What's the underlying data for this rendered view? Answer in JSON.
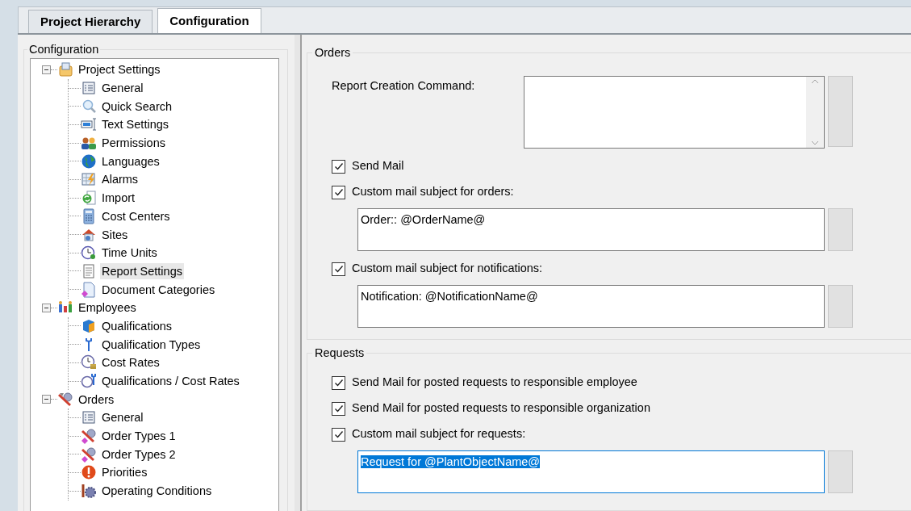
{
  "tabs": [
    {
      "label": "Project Hierarchy",
      "selected": false
    },
    {
      "label": "Configuration",
      "selected": true
    }
  ],
  "left_panel": {
    "title": "Configuration",
    "tree": [
      {
        "label": "Project Settings",
        "expanded": true,
        "selected": false,
        "children": [
          {
            "label": "General",
            "selected": false
          },
          {
            "label": "Quick Search",
            "selected": false
          },
          {
            "label": "Text Settings",
            "selected": false
          },
          {
            "label": "Permissions",
            "selected": false
          },
          {
            "label": "Languages",
            "selected": false
          },
          {
            "label": "Alarms",
            "selected": false
          },
          {
            "label": "Import",
            "selected": false
          },
          {
            "label": "Cost Centers",
            "selected": false
          },
          {
            "label": "Sites",
            "selected": false
          },
          {
            "label": "Time Units",
            "selected": false
          },
          {
            "label": "Report Settings",
            "selected": true
          },
          {
            "label": "Document Categories",
            "selected": false
          }
        ]
      },
      {
        "label": "Employees",
        "expanded": true,
        "selected": false,
        "children": [
          {
            "label": "Qualifications",
            "selected": false
          },
          {
            "label": "Qualification Types",
            "selected": false
          },
          {
            "label": "Cost Rates",
            "selected": false
          },
          {
            "label": "Qualifications / Cost Rates",
            "selected": false
          }
        ]
      },
      {
        "label": "Orders",
        "expanded": true,
        "selected": false,
        "children": [
          {
            "label": "General",
            "selected": false
          },
          {
            "label": "Order Types 1",
            "selected": false
          },
          {
            "label": "Order Types 2",
            "selected": false
          },
          {
            "label": "Priorities",
            "selected": false
          },
          {
            "label": "Operating Conditions",
            "selected": false
          }
        ]
      }
    ]
  },
  "sections": [
    {
      "title": "Orders",
      "items": [
        {
          "kind": "command",
          "label": "Report Creation Command:"
        },
        {
          "kind": "checkbox",
          "label": "Send Mail",
          "checked": true
        },
        {
          "kind": "checkbox",
          "label": "Custom mail subject for orders:",
          "checked": true
        },
        {
          "kind": "text_field",
          "value": "Order:: @OrderName@",
          "focused": false
        },
        {
          "kind": "checkbox",
          "label": "Custom mail subject for notifications:",
          "checked": true
        },
        {
          "kind": "text_field",
          "value": "Notification: @NotificationName@",
          "focused": false
        }
      ]
    },
    {
      "title": "Requests",
      "items": [
        {
          "kind": "checkbox",
          "label": "Send Mail for posted requests to responsible employee",
          "checked": true
        },
        {
          "kind": "checkbox",
          "label": "Send Mail for posted requests to responsible organization",
          "checked": true
        },
        {
          "kind": "checkbox",
          "label": "Custom mail subject for requests:",
          "checked": true
        },
        {
          "kind": "text_field",
          "value": "Request for @PlantObjectName@",
          "focused": true
        }
      ]
    }
  ]
}
